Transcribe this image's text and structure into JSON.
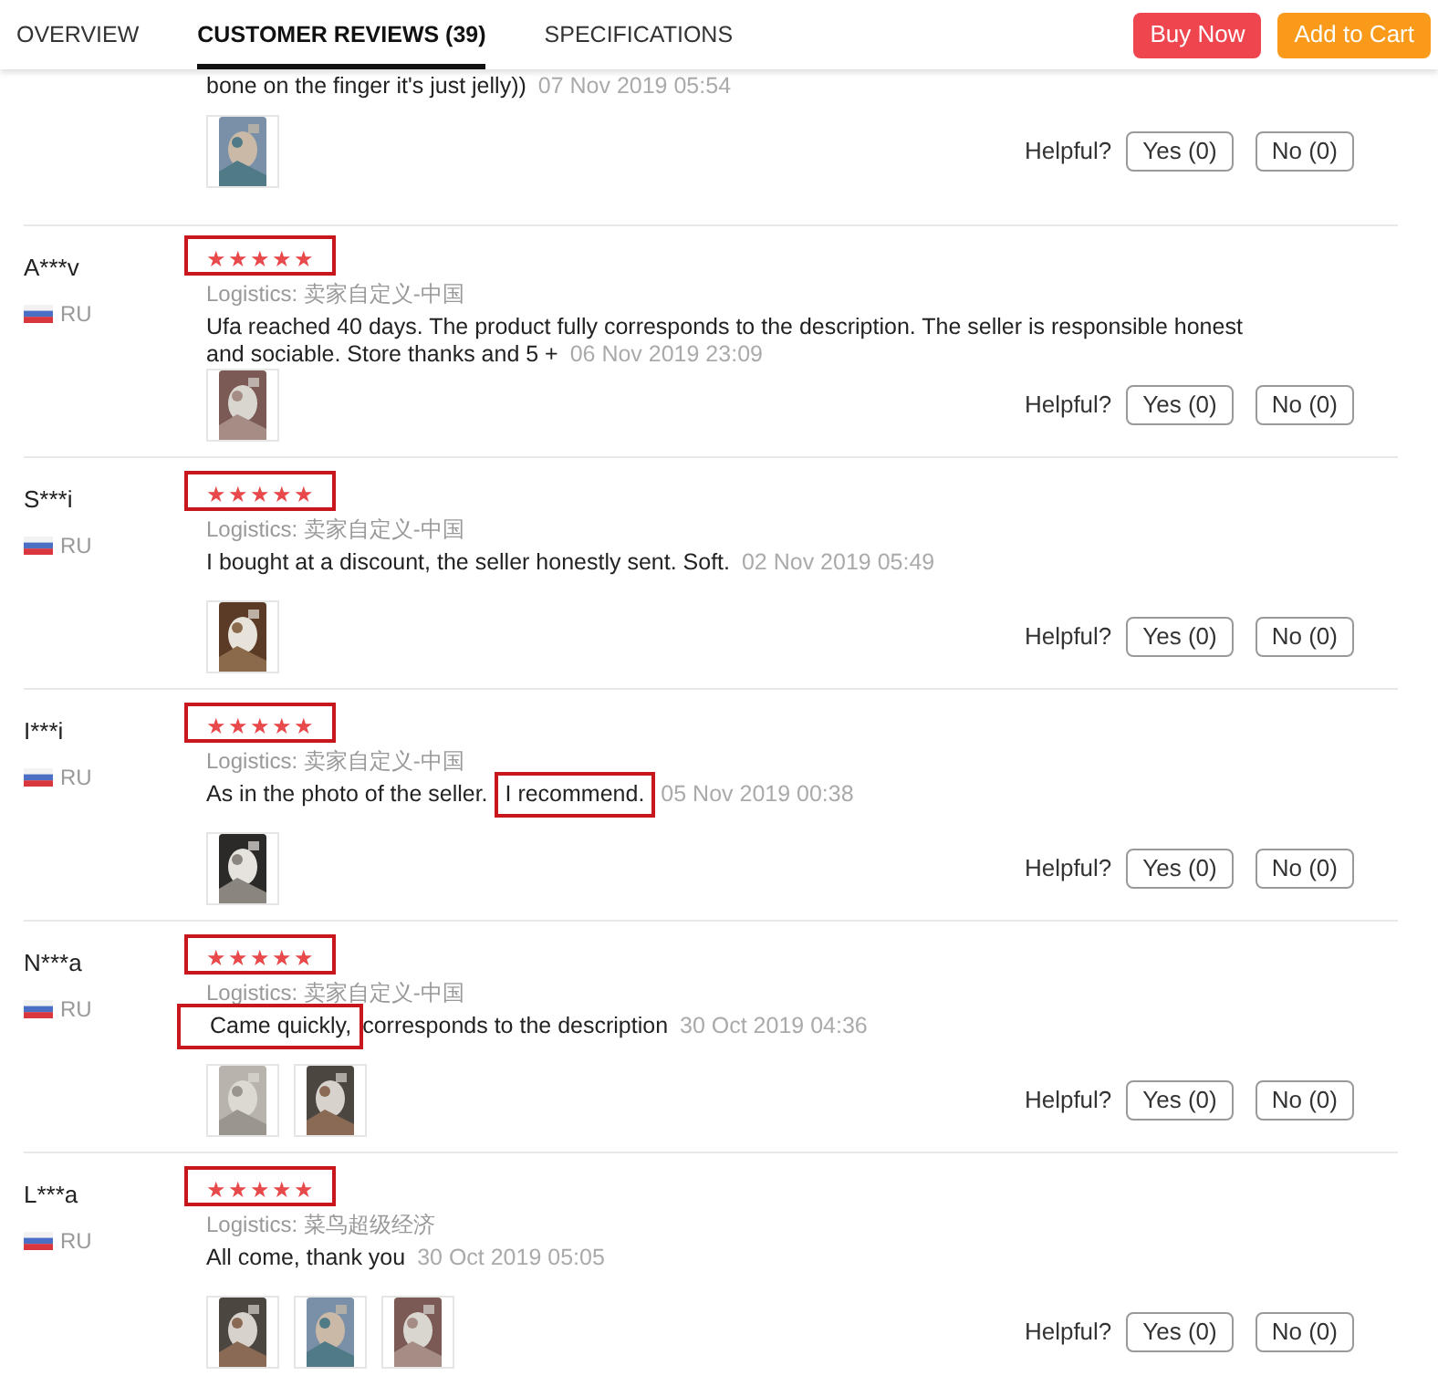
{
  "tabs": [
    {
      "label": "OVERVIEW",
      "selected": false
    },
    {
      "label": "CUSTOMER REVIEWS (39)",
      "selected": true
    },
    {
      "label": "SPECIFICATIONS",
      "selected": false
    }
  ],
  "actions": [
    {
      "label": "Buy Now",
      "kind": "buy"
    },
    {
      "label": "Add to Cart",
      "kind": "cart"
    }
  ],
  "partial_review": {
    "text": "bone on the finger it's just jelly))",
    "date": "07 Nov 2019 05:54",
    "photos": [
      {
        "kind": "picture"
      }
    ],
    "helpful_label": "Helpful?",
    "yes": "Yes (0)",
    "no": "No (0)"
  },
  "reviews": [
    {
      "name": "A***v",
      "country": "RU",
      "stars": 5,
      "rating_highlighted": true,
      "logistics": "Logistics: 卖家自定义-中国",
      "text": [
        {
          "text": "Ufa reached 40 days. The product fully corresponds to the description. The seller is responsible honest and sociable. Store thanks and 5 +",
          "highlighted": false
        }
      ],
      "date": "06 Nov 2019 23:09",
      "photos": [
        {
          "kind": "picture"
        }
      ],
      "helpful_label": "Helpful?",
      "yes": "Yes (0)",
      "no": "No (0)"
    },
    {
      "name": "S***i",
      "country": "RU",
      "stars": 5,
      "rating_highlighted": true,
      "logistics": "Logistics: 卖家自定义-中国",
      "text": [
        {
          "text": "I bought at a discount, the seller honestly sent. Soft.",
          "highlighted": false
        }
      ],
      "date": "02 Nov 2019 05:49",
      "photos": [
        {
          "kind": "picture"
        }
      ],
      "helpful_label": "Helpful?",
      "yes": "Yes (0)",
      "no": "No (0)"
    },
    {
      "name": "I***i",
      "country": "RU",
      "stars": 5,
      "rating_highlighted": true,
      "logistics": "Logistics: 卖家自定义-中国",
      "text": [
        {
          "text": "As in the photo of the seller.",
          "highlighted": false
        },
        {
          "text": "I recommend.",
          "highlighted": true
        }
      ],
      "date": "05 Nov 2019 00:38",
      "photos": [
        {
          "kind": "picture"
        }
      ],
      "helpful_label": "Helpful?",
      "yes": "Yes (0)",
      "no": "No (0)"
    },
    {
      "name": "N***a",
      "country": "RU",
      "stars": 5,
      "rating_highlighted": true,
      "logistics": "Logistics: 卖家自定义-中国",
      "text": [
        {
          "text": "Came quickly,",
          "highlighted": true
        },
        {
          "text": "corresponds to the description",
          "highlighted": false
        }
      ],
      "date": "30 Oct 2019 04:36",
      "photos": [
        {
          "kind": "picture"
        },
        {
          "kind": "picture"
        }
      ],
      "helpful_label": "Helpful?",
      "yes": "Yes (0)",
      "no": "No (0)"
    },
    {
      "name": "L***a",
      "country": "RU",
      "stars": 5,
      "rating_highlighted": true,
      "logistics": "Logistics: 菜鸟超级经济",
      "text": [
        {
          "text": "All come, thank you",
          "highlighted": false
        }
      ],
      "date": "30 Oct 2019 05:05",
      "photos": [
        {
          "kind": "picture"
        },
        {
          "kind": "picture"
        },
        {
          "kind": "picture"
        }
      ],
      "helpful_label": "Helpful?",
      "yes": "Yes (0)",
      "no": "No (0)"
    }
  ]
}
